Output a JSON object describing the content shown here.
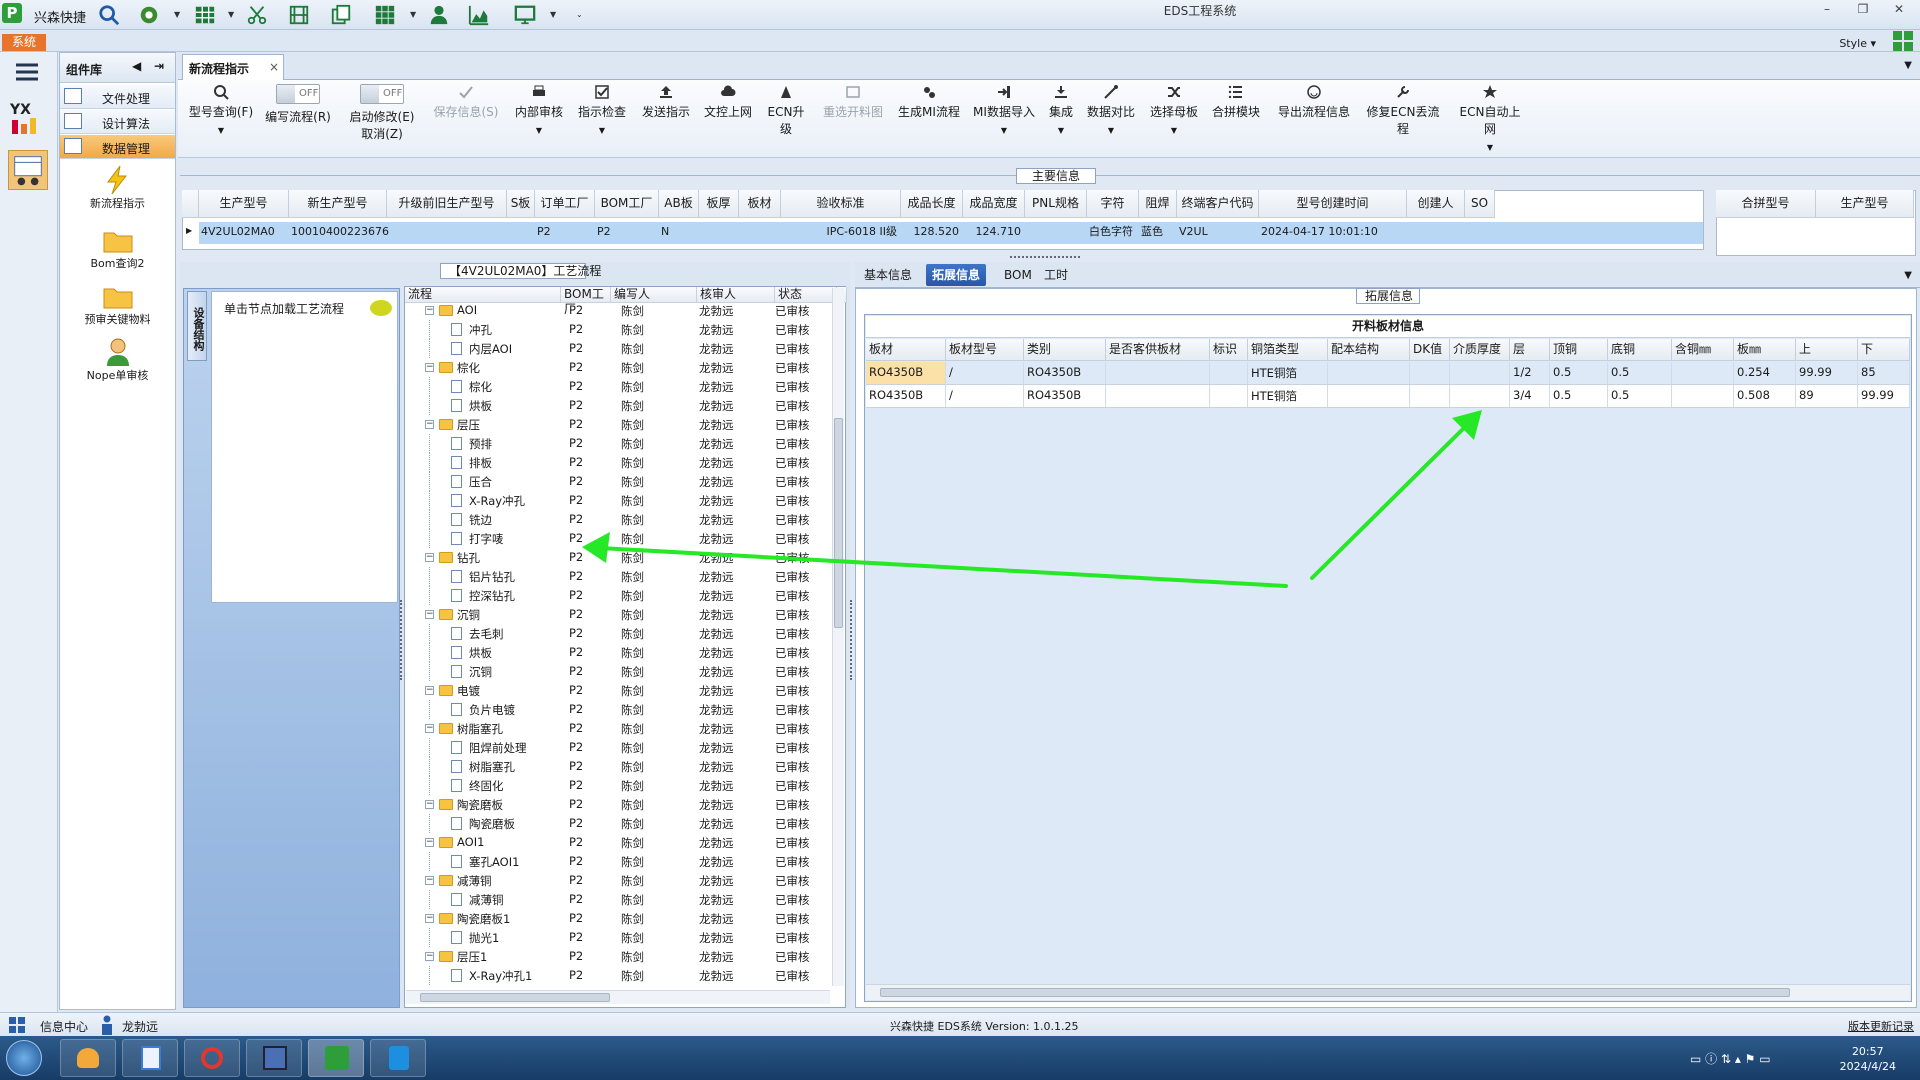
{
  "app": {
    "name": "兴森快捷",
    "window_title": "EDS工程系统",
    "style_label": "Style",
    "system_btn": "系统"
  },
  "component_lib": {
    "title": "组件库",
    "categories": [
      {
        "label": "文件处理"
      },
      {
        "label": "设计算法"
      },
      {
        "label": "数据管理"
      }
    ],
    "items": [
      {
        "label": "新流程指示"
      },
      {
        "label": "Bom查询2"
      },
      {
        "label": "预审关键物料"
      },
      {
        "label": "Nope单审核"
      }
    ]
  },
  "tab": {
    "label": "新流程指示",
    "close": "×"
  },
  "toolbar": {
    "query": "型号查询(F)",
    "write": "编写流程(R)",
    "start_modify": "启动修改(E)",
    "cancel": "取消(Z)",
    "save": "保存信息(S)",
    "internal_review": "内部审核",
    "instr_check": "指示检查",
    "send": "发送指示",
    "doc_upload": "文控上网",
    "ecn": "ECN升级",
    "reselect": "重选开料图",
    "gen_mi": "生成MI流程",
    "mi_import": "MI数据导入",
    "integrate": "集成",
    "compare": "数据对比",
    "mother": "选择母板",
    "merge": "合拼模块",
    "export": "导出流程信息",
    "fix_ecn": "修复ECN丢流程",
    "ecn_auto": "ECN自动上网",
    "off": "OFF"
  },
  "main_info": {
    "caption": "主要信息",
    "headers": [
      "生产型号",
      "新生产型号",
      "升级前旧生产型号",
      "S板",
      "订单工厂",
      "BOM工厂",
      "AB板",
      "板厚",
      "板材",
      "验收标准",
      "成品长度",
      "成品宽度",
      "PNL规格",
      "字符",
      "阻焊",
      "终端客户代码",
      "型号创建时间",
      "创建人",
      "SO"
    ],
    "row": [
      "4V2UL02MA0",
      "10010400223676",
      "",
      "",
      "P2",
      "P2",
      "N",
      "",
      "",
      "IPC-6018 II级",
      "128.520",
      "124.710",
      "",
      "白色字符",
      "蓝色",
      "V2UL",
      "2024-04-17 10:01:10",
      "",
      ""
    ],
    "right_headers": [
      "合拼型号",
      "生产型号"
    ]
  },
  "process": {
    "caption": "【4V2UL02MA0】工艺流程",
    "side_tab": "设备结构",
    "hint": "单击节点加载工艺流程",
    "headers": [
      "流程",
      "BOM工厂",
      "编写人",
      "核审人",
      "状态"
    ],
    "rows": [
      {
        "name": "AOI",
        "level": 0,
        "f": "P2",
        "w": "陈剑",
        "r": "龙勃远",
        "s": "已审核"
      },
      {
        "name": "冲孔",
        "level": 1,
        "f": "P2",
        "w": "陈剑",
        "r": "龙勃远",
        "s": "已审核"
      },
      {
        "name": "内层AOI",
        "level": 1,
        "f": "P2",
        "w": "陈剑",
        "r": "龙勃远",
        "s": "已审核"
      },
      {
        "name": "棕化",
        "level": 0,
        "f": "P2",
        "w": "陈剑",
        "r": "龙勃远",
        "s": "已审核"
      },
      {
        "name": "棕化",
        "level": 1,
        "f": "P2",
        "w": "陈剑",
        "r": "龙勃远",
        "s": "已审核"
      },
      {
        "name": "烘板",
        "level": 1,
        "f": "P2",
        "w": "陈剑",
        "r": "龙勃远",
        "s": "已审核"
      },
      {
        "name": "层压",
        "level": 0,
        "f": "P2",
        "w": "陈剑",
        "r": "龙勃远",
        "s": "已审核"
      },
      {
        "name": "预排",
        "level": 1,
        "f": "P2",
        "w": "陈剑",
        "r": "龙勃远",
        "s": "已审核"
      },
      {
        "name": "排板",
        "level": 1,
        "f": "P2",
        "w": "陈剑",
        "r": "龙勃远",
        "s": "已审核"
      },
      {
        "name": "压合",
        "level": 1,
        "f": "P2",
        "w": "陈剑",
        "r": "龙勃远",
        "s": "已审核"
      },
      {
        "name": "X-Ray冲孔",
        "level": 1,
        "f": "P2",
        "w": "陈剑",
        "r": "龙勃远",
        "s": "已审核"
      },
      {
        "name": "铣边",
        "level": 1,
        "f": "P2",
        "w": "陈剑",
        "r": "龙勃远",
        "s": "已审核"
      },
      {
        "name": "打字唛",
        "level": 1,
        "f": "P2",
        "w": "陈剑",
        "r": "龙勃远",
        "s": "已审核"
      },
      {
        "name": "钻孔",
        "level": 0,
        "f": "P2",
        "w": "陈剑",
        "r": "龙勃远",
        "s": "已审核"
      },
      {
        "name": "铝片钻孔",
        "level": 1,
        "f": "P2",
        "w": "陈剑",
        "r": "龙勃远",
        "s": "已审核"
      },
      {
        "name": "控深钻孔",
        "level": 1,
        "f": "P2",
        "w": "陈剑",
        "r": "龙勃远",
        "s": "已审核"
      },
      {
        "name": "沉铜",
        "level": 0,
        "f": "P2",
        "w": "陈剑",
        "r": "龙勃远",
        "s": "已审核"
      },
      {
        "name": "去毛刺",
        "level": 1,
        "f": "P2",
        "w": "陈剑",
        "r": "龙勃远",
        "s": "已审核"
      },
      {
        "name": "烘板",
        "level": 1,
        "f": "P2",
        "w": "陈剑",
        "r": "龙勃远",
        "s": "已审核"
      },
      {
        "name": "沉铜",
        "level": 1,
        "f": "P2",
        "w": "陈剑",
        "r": "龙勃远",
        "s": "已审核"
      },
      {
        "name": "电镀",
        "level": 0,
        "f": "P2",
        "w": "陈剑",
        "r": "龙勃远",
        "s": "已审核"
      },
      {
        "name": "负片电镀",
        "level": 1,
        "f": "P2",
        "w": "陈剑",
        "r": "龙勃远",
        "s": "已审核"
      },
      {
        "name": "树脂塞孔",
        "level": 0,
        "f": "P2",
        "w": "陈剑",
        "r": "龙勃远",
        "s": "已审核"
      },
      {
        "name": "阻焊前处理",
        "level": 1,
        "f": "P2",
        "w": "陈剑",
        "r": "龙勃远",
        "s": "已审核"
      },
      {
        "name": "树脂塞孔",
        "level": 1,
        "f": "P2",
        "w": "陈剑",
        "r": "龙勃远",
        "s": "已审核"
      },
      {
        "name": "终固化",
        "level": 1,
        "f": "P2",
        "w": "陈剑",
        "r": "龙勃远",
        "s": "已审核"
      },
      {
        "name": "陶瓷磨板",
        "level": 0,
        "f": "P2",
        "w": "陈剑",
        "r": "龙勃远",
        "s": "已审核"
      },
      {
        "name": "陶瓷磨板",
        "level": 1,
        "f": "P2",
        "w": "陈剑",
        "r": "龙勃远",
        "s": "已审核"
      },
      {
        "name": "AOI1",
        "level": 0,
        "f": "P2",
        "w": "陈剑",
        "r": "龙勃远",
        "s": "已审核"
      },
      {
        "name": "塞孔AOI1",
        "level": 1,
        "f": "P2",
        "w": "陈剑",
        "r": "龙勃远",
        "s": "已审核"
      },
      {
        "name": "减薄铜",
        "level": 0,
        "f": "P2",
        "w": "陈剑",
        "r": "龙勃远",
        "s": "已审核"
      },
      {
        "name": "减薄铜",
        "level": 1,
        "f": "P2",
        "w": "陈剑",
        "r": "龙勃远",
        "s": "已审核"
      },
      {
        "name": "陶瓷磨板1",
        "level": 0,
        "f": "P2",
        "w": "陈剑",
        "r": "龙勃远",
        "s": "已审核"
      },
      {
        "name": "抛光1",
        "level": 1,
        "f": "P2",
        "w": "陈剑",
        "r": "龙勃远",
        "s": "已审核"
      },
      {
        "name": "层压1",
        "level": 0,
        "f": "P2",
        "w": "陈剑",
        "r": "龙勃远",
        "s": "已审核"
      },
      {
        "name": "X-Ray冲孔1",
        "level": 1,
        "f": "P2",
        "w": "陈剑",
        "r": "龙勃远",
        "s": "已审核"
      }
    ]
  },
  "detail": {
    "tabs": [
      "基本信息",
      "拓展信息",
      "BOM",
      "工时"
    ],
    "active_tab": 1,
    "caption": "拓展信息",
    "table_title": "开料板材信息",
    "headers": [
      "板材",
      "板材型号",
      "类别",
      "是否客供板材",
      "标识",
      "铜箔类型",
      "配本结构",
      "DK值",
      "介质厚度",
      "层",
      "顶铜",
      "底铜",
      "含铜㎜",
      "板㎜",
      "上",
      "下"
    ],
    "rows": [
      [
        "RO4350B",
        "/",
        "RO4350B",
        "",
        "",
        "HTE铜箔",
        "",
        "",
        "",
        "1/2",
        "0.5",
        "0.5",
        "",
        "0.254",
        "99.99",
        "85"
      ],
      [
        "RO4350B",
        "/",
        "RO4350B",
        "",
        "",
        "HTE铜箔",
        "",
        "",
        "",
        "3/4",
        "0.5",
        "0.5",
        "",
        "0.508",
        "89",
        "99.99"
      ]
    ]
  },
  "status": {
    "info_center": "信息中心",
    "user": "龙勃远",
    "version": "兴森快捷 EDS系统 Version: 1.0.1.25",
    "update_log": "版本更新记录"
  },
  "taskbar": {
    "time": "20:57",
    "date": "2024/4/24"
  },
  "colors": {
    "accent_blue": "#2857a6",
    "selection": "#b7d7f5",
    "arrow_green": "#27e827",
    "orange": "#e8742c"
  }
}
